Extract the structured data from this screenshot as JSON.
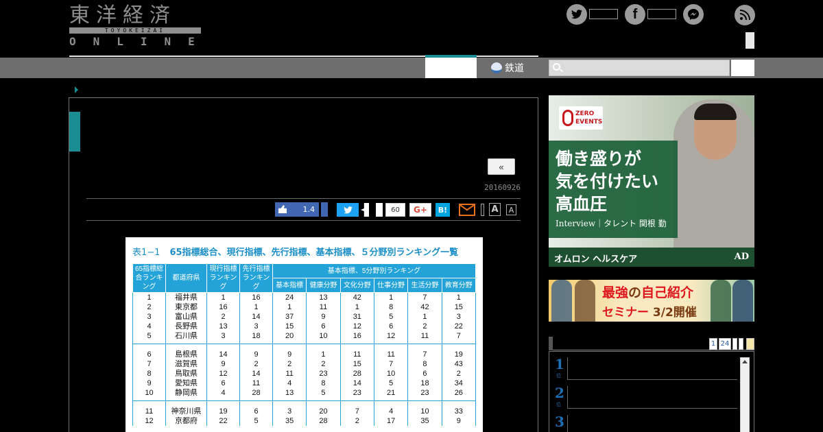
{
  "header": {
    "logo_kanji": "東洋経済",
    "logo_sub": "TOYOKEIZAI",
    "logo_online": "ONLINE"
  },
  "nav": {
    "tab_label": "鉄道",
    "search_placeholder": ""
  },
  "article": {
    "prev_label": "«",
    "date": "20160926",
    "share": {
      "fb_like_count": "1.4",
      "share_count": "60",
      "gplus_label": "G+",
      "hatena_label": "B!",
      "font_large_label": "A",
      "font_small_label": "A"
    }
  },
  "table": {
    "caption_num": "表1−1",
    "caption_title": "65指標総合、現行指標、先行指標、基本指標、５分野別ランキング一覧",
    "group_header": "基本指標、5分野別ランキング",
    "headers": [
      "65指標総合ランキング",
      "都道府県",
      "現行指標ランキング",
      "先行指標ランキング",
      "基本指標",
      "健康分野",
      "文化分野",
      "仕事分野",
      "生活分野",
      "教育分野"
    ],
    "rows": [
      [
        "1",
        "福井県",
        "1",
        "16",
        "24",
        "13",
        "42",
        "1",
        "7",
        "1"
      ],
      [
        "2",
        "東京都",
        "16",
        "1",
        "1",
        "11",
        "1",
        "8",
        "42",
        "15"
      ],
      [
        "3",
        "富山県",
        "2",
        "14",
        "37",
        "9",
        "31",
        "5",
        "1",
        "3"
      ],
      [
        "4",
        "長野県",
        "13",
        "3",
        "15",
        "6",
        "12",
        "6",
        "2",
        "22"
      ],
      [
        "5",
        "石川県",
        "3",
        "18",
        "20",
        "10",
        "16",
        "12",
        "11",
        "7"
      ],
      [
        "6",
        "島根県",
        "14",
        "9",
        "9",
        "1",
        "11",
        "11",
        "7",
        "19"
      ],
      [
        "7",
        "滋賀県",
        "9",
        "2",
        "2",
        "2",
        "15",
        "7",
        "8",
        "43"
      ],
      [
        "8",
        "鳥取県",
        "12",
        "14",
        "11",
        "23",
        "28",
        "10",
        "6",
        "2"
      ],
      [
        "9",
        "愛知県",
        "6",
        "11",
        "4",
        "8",
        "14",
        "5",
        "18",
        "34"
      ],
      [
        "10",
        "静岡県",
        "4",
        "28",
        "13",
        "5",
        "23",
        "21",
        "23",
        "26"
      ],
      [
        "11",
        "神奈川県",
        "19",
        "6",
        "3",
        "20",
        "7",
        "4",
        "10",
        "33"
      ],
      [
        "12",
        "京都府",
        "22",
        "5",
        "35",
        "28",
        "2",
        "17",
        "35",
        "9"
      ]
    ]
  },
  "sidebar": {
    "ad1": {
      "logo_text": "ZERO EVENTS",
      "headline": "働き盛りが\n気を付けたい\n高血圧",
      "subline": "Interview｜タレント 関根 勤",
      "brand": "オムロン ヘルスケア",
      "ad_label": "AD"
    },
    "ad2": {
      "title_a": "最強",
      "title_b": "の",
      "title_c": "自己紹介",
      "date_a": "セミナー",
      "date_b": "3/2開催"
    },
    "ranking": {
      "pages": [
        "1",
        "24",
        "",
        ""
      ],
      "numbers": [
        "1",
        "2",
        "3"
      ],
      "suffix": "位"
    }
  },
  "colors": {
    "accent": "#1b8c92",
    "nav_bar": "#6e6e6e",
    "table_header": "#24a3d8",
    "facebook": "#4267b2",
    "twitter": "#1da1f2",
    "hatena": "#00a4de",
    "mail": "#e8711b"
  }
}
